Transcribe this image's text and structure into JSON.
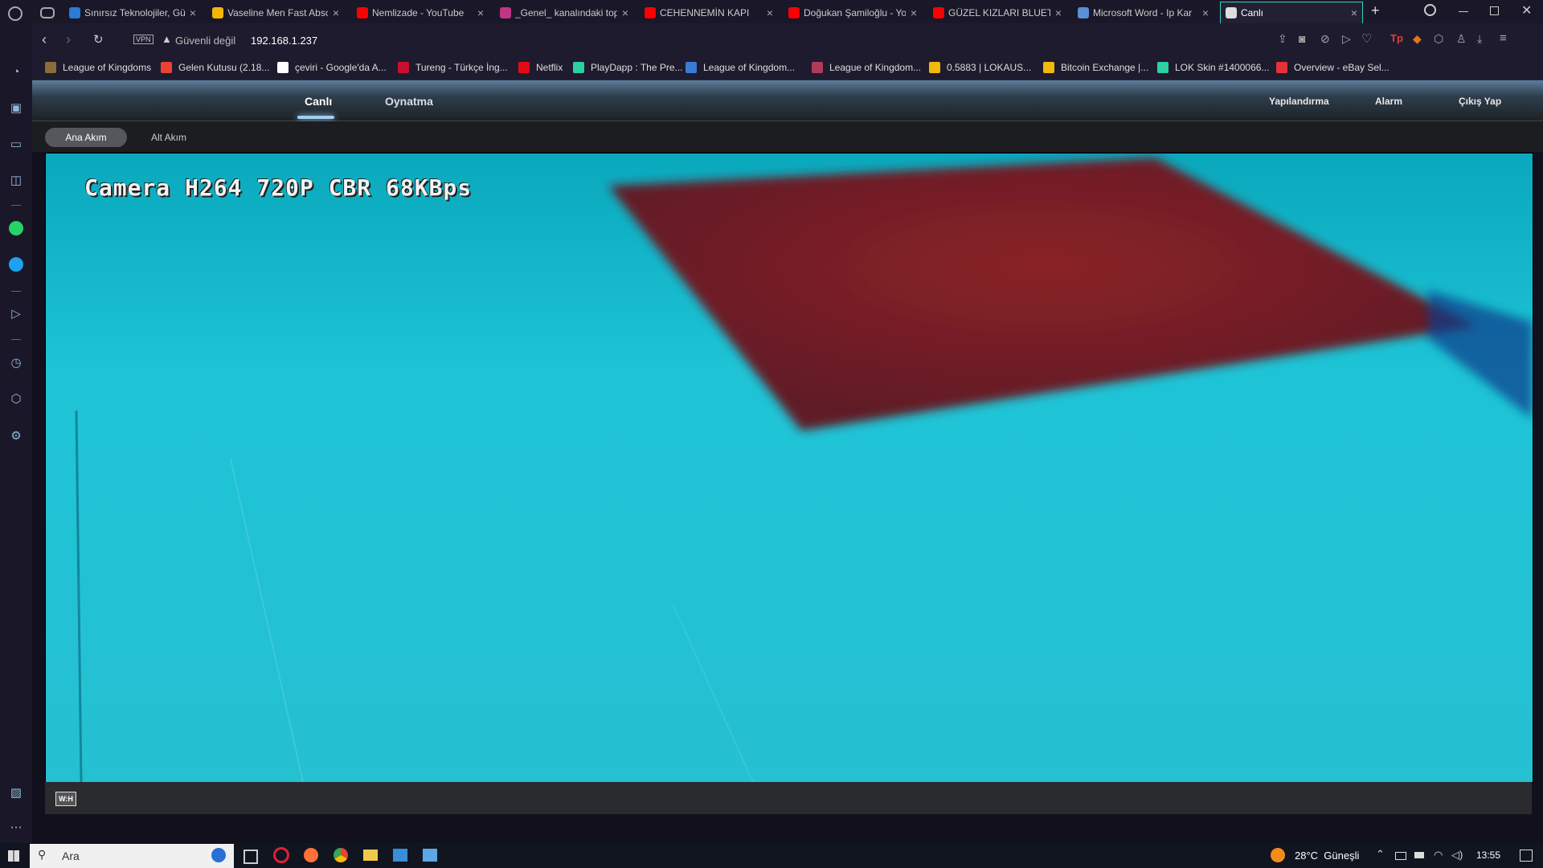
{
  "tabs": [
    {
      "title": "Sınırsız Teknolojiler, Gü",
      "color": "#2a7bd6"
    },
    {
      "title": "Vaseline Men Fast Abso",
      "color": "#f2b705"
    },
    {
      "title": "Nemlizade - YouTube",
      "color": "#ff0000"
    },
    {
      "title": "_Genel_ kanalındaki top",
      "color": "#c13584"
    },
    {
      "title": "CEHENNEMİN KAPI",
      "color": "#ff0000"
    },
    {
      "title": "Doğukan Şamiloğlu - Yo",
      "color": "#ff0000"
    },
    {
      "title": "GÜZEL KIZLARI BLUETO",
      "color": "#ff0000"
    },
    {
      "title": "Microsoft Word - Ip Kar",
      "color": "#5b8fd6"
    },
    {
      "title": "Canlı",
      "color": "#dddddd"
    }
  ],
  "address": {
    "vpn_label": "VPN",
    "security": "Güvenli değil",
    "url": "192.168.1.237"
  },
  "bookmarks": [
    {
      "label": "League of Kingdoms",
      "color": "#8a6d3b"
    },
    {
      "label": "Gelen Kutusu (2.18...",
      "color": "#ea4335"
    },
    {
      "label": "çeviri - Google'da A...",
      "color": "#ffffff"
    },
    {
      "label": "Tureng - Türkçe İng...",
      "color": "#c8102e"
    },
    {
      "label": "Netflix",
      "color": "#e50914"
    },
    {
      "label": "PlayDapp : The Pre...",
      "color": "#2bd1a0"
    },
    {
      "label": "League of Kingdom...",
      "color": "#3a7bd5"
    },
    {
      "label": "League of Kingdom...",
      "color": "#b03a5a"
    },
    {
      "label": "0.5883 | LOKAUS...",
      "color": "#f0b90b"
    },
    {
      "label": "Bitcoin Exchange |...",
      "color": "#f0b90b"
    },
    {
      "label": "LOK Skin #1400066...",
      "color": "#2bd1a0"
    },
    {
      "label": "Overview - eBay Sel...",
      "color": "#e53238"
    }
  ],
  "camera": {
    "nav_left": [
      "Canlı",
      "Oynatma"
    ],
    "nav_right": [
      "Yapılandırma",
      "Alarm",
      "Çıkış Yap"
    ],
    "streams": [
      "Ana Akım",
      "Alt Akım"
    ],
    "osd_text": "Camera H264 720P CBR 68KBps",
    "ratio_label": "W:H"
  },
  "taskbar": {
    "search_placeholder": "Ara",
    "weather": "28°C  Güneşli",
    "time": "13:55"
  }
}
